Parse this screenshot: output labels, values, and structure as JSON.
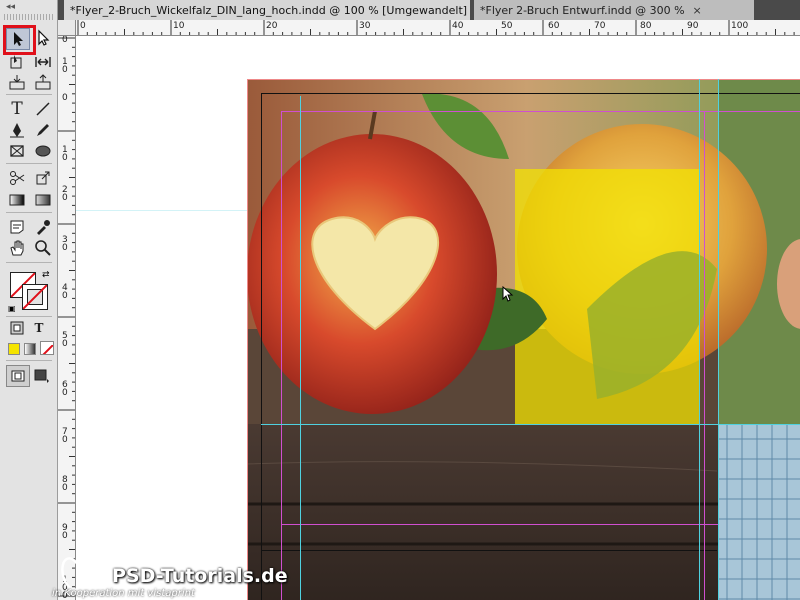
{
  "tabs": [
    {
      "label": "*Flyer_2-Bruch_Wickelfalz_DIN_lang_hoch.indd @ 100 % [Umgewandelt]",
      "active": true
    },
    {
      "label": "*Flyer 2-Bruch Entwurf.indd @ 300 %",
      "active": false
    }
  ],
  "tab_close": "×",
  "tools_panel": {
    "collapse": "◂◂",
    "type_tool_glyph": "T",
    "format_text_glyph": "T",
    "selected_tool": "selection-tool"
  },
  "rulers": {
    "horizontal": [
      "0",
      "10",
      "20",
      "30",
      "40",
      "50",
      "60",
      "70",
      "80",
      "90",
      "100"
    ],
    "vertical": [
      "0",
      "1\n0",
      "0",
      "1\n0",
      "2\n0",
      "3\n0",
      "4\n0",
      "5\n0",
      "6\n0",
      "7\n0",
      "8\n0",
      "9\n0",
      "1\n0\n0"
    ]
  },
  "watermark": {
    "brand": "PSD-Tutorials.de",
    "subline": "in Kooperation mit  vistaprint"
  },
  "colors": {
    "highlight": "#e0101a",
    "guide_cyan": "#4fd1e0",
    "guide_magenta": "#d04fd0",
    "apple_red": "#c83a2a",
    "wood": "#3d2f28"
  }
}
